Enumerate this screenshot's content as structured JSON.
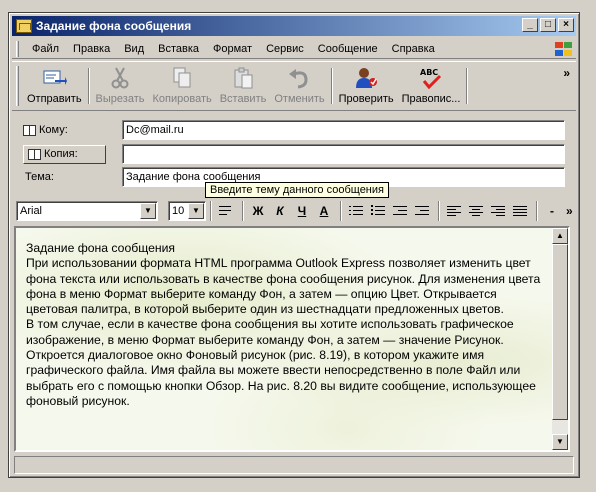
{
  "window": {
    "title": "Задание фона сообщения"
  },
  "menu": {
    "items": [
      "Файл",
      "Правка",
      "Вид",
      "Вставка",
      "Формат",
      "Сервис",
      "Сообщение",
      "Справка"
    ]
  },
  "toolbar": {
    "send": "Отправить",
    "cut": "Вырезать",
    "copy": "Копировать",
    "paste": "Вставить",
    "undo": "Отменить",
    "check": "Проверить",
    "spelling": "Правопис...",
    "spelling_icon_text": "ABC"
  },
  "header": {
    "to_label": "Кому:",
    "to_value": "Dc@mail.ru",
    "cc_label": "Копия:",
    "cc_value": "",
    "subject_label": "Тема:",
    "subject_value": "Задание фона сообщения"
  },
  "tooltip": "Введите тему данного сообщения",
  "format": {
    "font": "Arial",
    "size": "10",
    "bold": "Ж",
    "italic": "К",
    "underline": "Ч",
    "color": "А"
  },
  "body": {
    "paragraphs": [
      "Задание фона сообщения",
      "При использовании формата HTML программа Outlook Express позволяет изменить цвет фона текста или использовать в качестве фона сообщения рисунок. Для изменения цвета фона в меню Формат выберите команду Фон, а затем — опцию Цвет. Открывается цветовая палитра, в которой выберите один из шестнадцати предложенных цветов.",
      "В том случае, если в качестве фона сообщения вы хотите использовать графическое изображение, в меню Формат выберите команду Фон, а затем — значение Рисунок. Откроется диалоговое окно Фоновый рисунок (рис. 8.19), в котором укажите имя графического файла. Имя файла вы можете ввести непосредственно в поле Файл или выбрать его с помощью кнопки Обзор. На рис. 8.20 вы видите сообщение, использующее фоновый рисунок."
    ]
  },
  "colors": {
    "titlebar_start": "#0a246a",
    "titlebar_end": "#a6caf0",
    "chrome": "#d4d0c8",
    "tooltip_bg": "#ffffe1"
  }
}
